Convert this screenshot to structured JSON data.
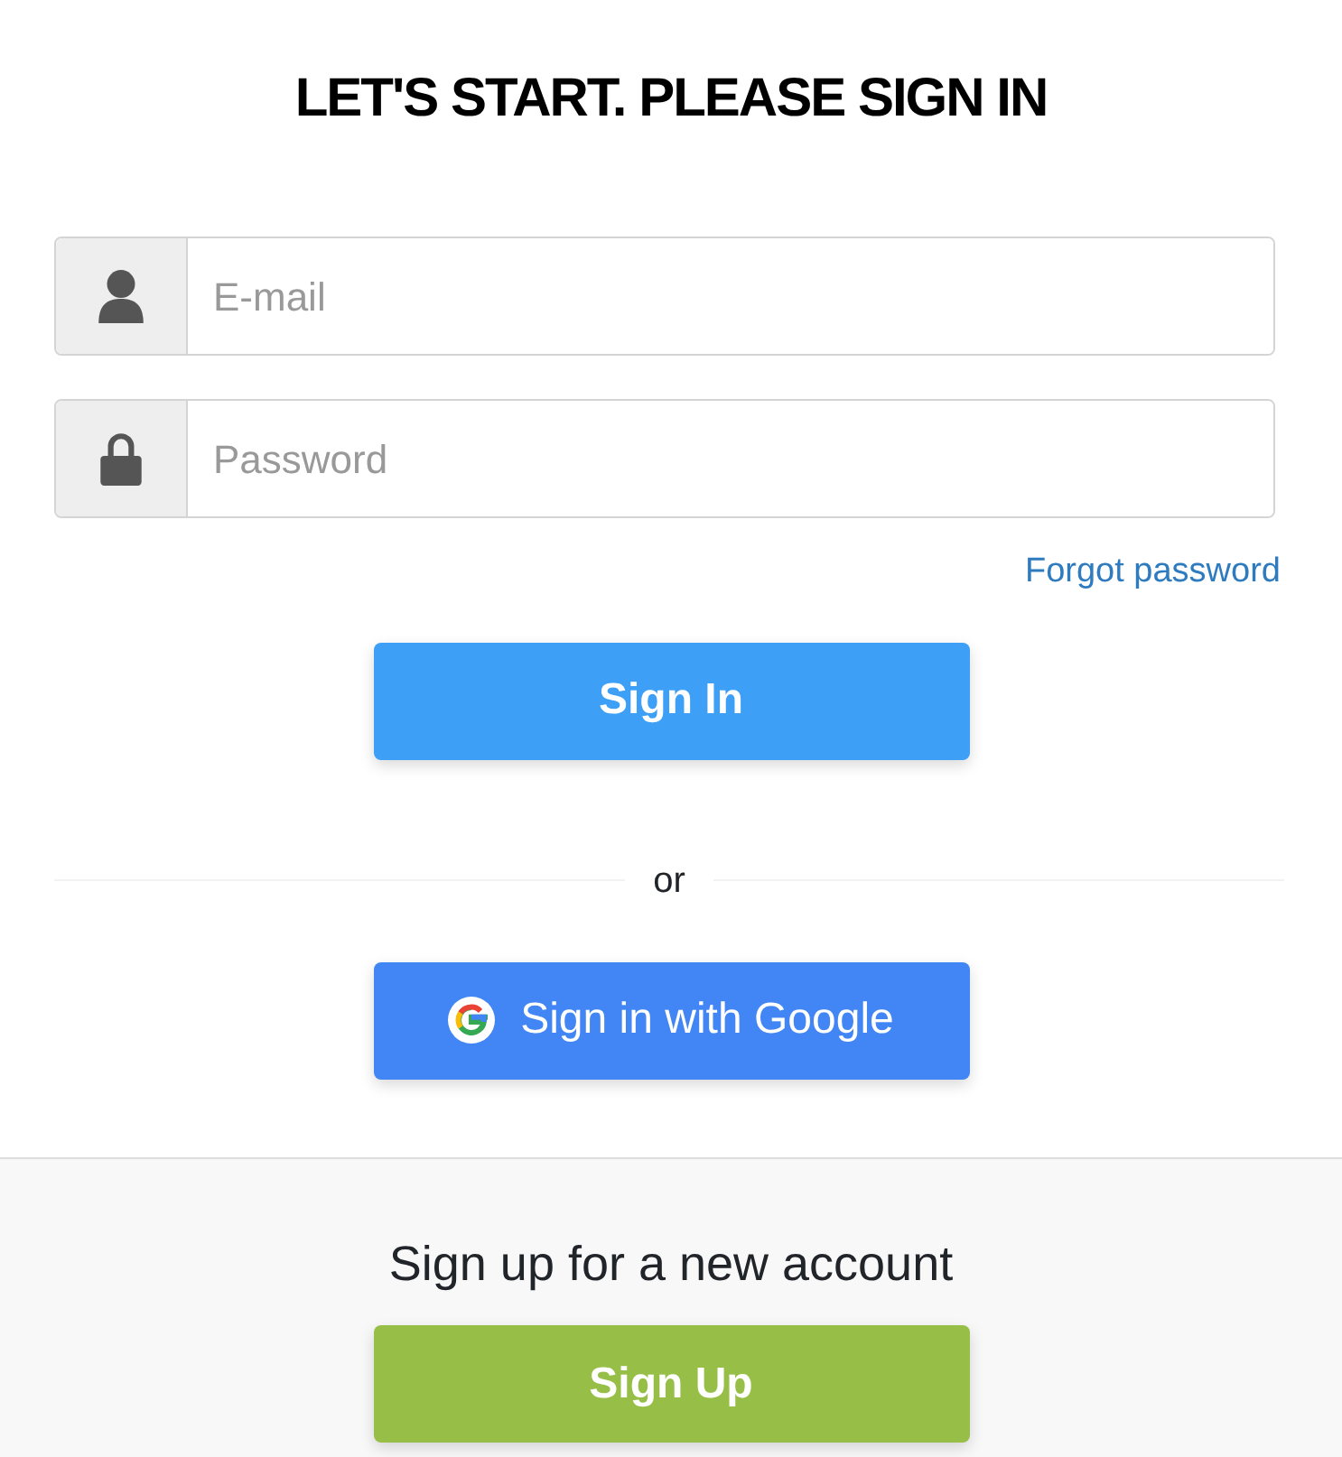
{
  "title": "LET'S START. PLEASE SIGN IN",
  "fields": [
    {
      "kind": "email",
      "placeholder": "E-mail"
    },
    {
      "kind": "password",
      "placeholder": "Password"
    }
  ],
  "forgot_link": "Forgot password",
  "sign_in_button": "Sign In",
  "divider_text": "or",
  "google_button": "Sign in with Google",
  "footer": {
    "text": "Sign up for a new account",
    "button": "Sign Up"
  }
}
